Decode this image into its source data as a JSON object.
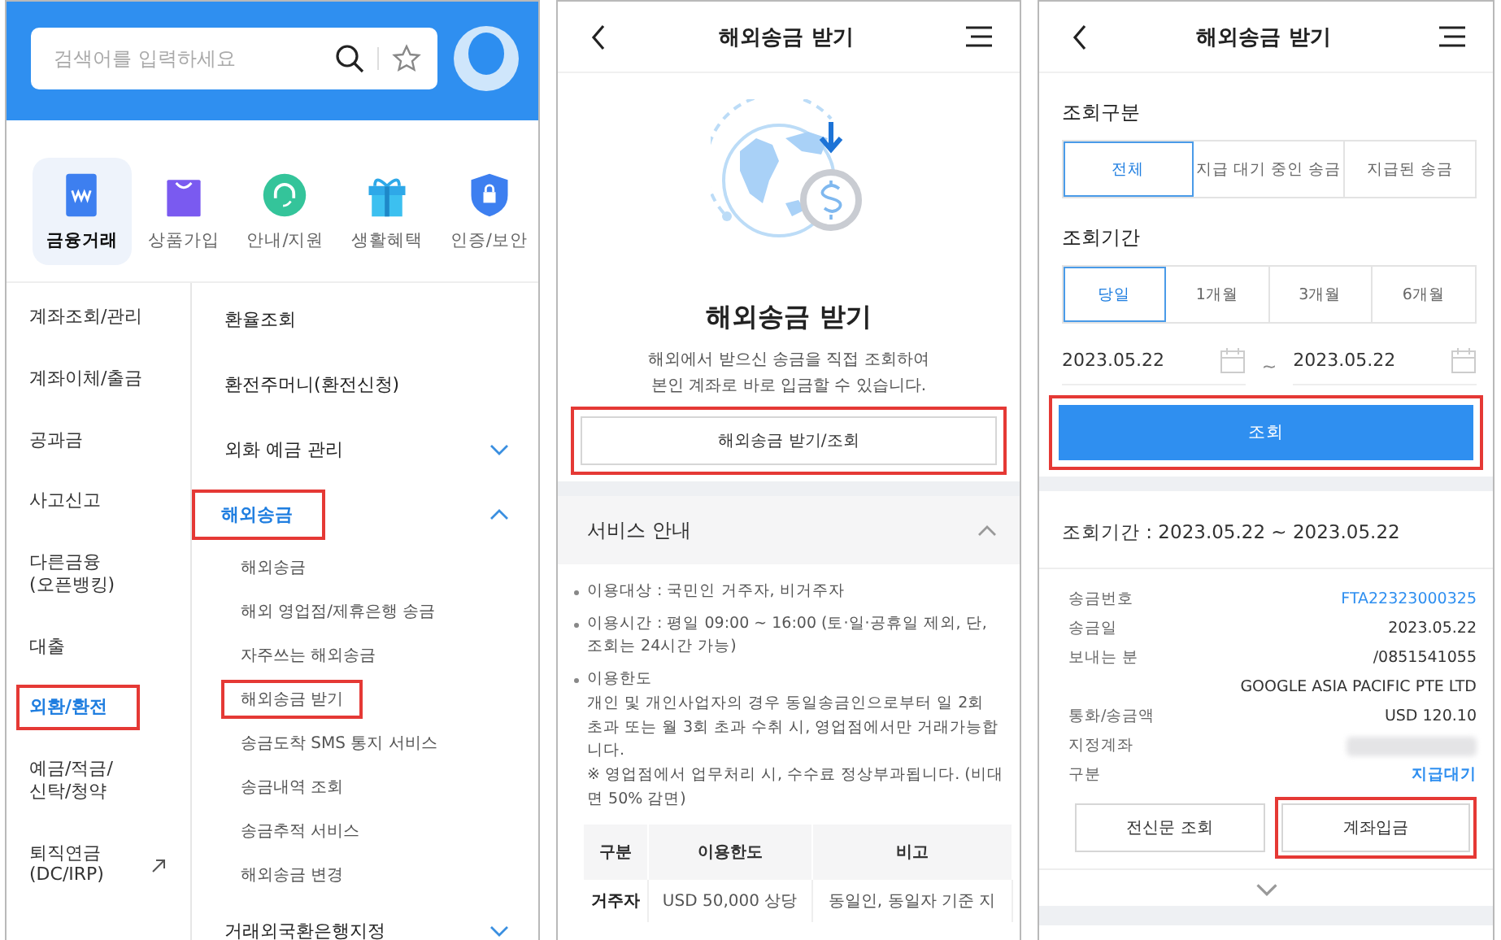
{
  "menu_screen": {
    "search": {
      "placeholder": "검색어를 입력하세요"
    },
    "categories": [
      {
        "label": "금융거래",
        "kind": "finance",
        "selected": true
      },
      {
        "label": "상품가입",
        "kind": "shop",
        "selected": false
      },
      {
        "label": "안내/지원",
        "kind": "support",
        "selected": false
      },
      {
        "label": "생활혜택",
        "kind": "gift",
        "selected": false
      },
      {
        "label": "인증/보안",
        "kind": "security",
        "selected": false
      }
    ],
    "left_menu": [
      {
        "label": "계좌조회/관리",
        "selected": false,
        "highlighted": false,
        "external": false
      },
      {
        "label": "계좌이체/출금",
        "selected": false,
        "highlighted": false,
        "external": false
      },
      {
        "label": "공과금",
        "selected": false,
        "highlighted": false,
        "external": false
      },
      {
        "label": "사고신고",
        "selected": false,
        "highlighted": false,
        "external": false
      },
      {
        "label": "다른금융\n(오픈뱅킹)",
        "selected": false,
        "highlighted": false,
        "external": false
      },
      {
        "label": "대출",
        "selected": false,
        "highlighted": false,
        "external": false
      },
      {
        "label": "외환/환전",
        "selected": true,
        "highlighted": true,
        "external": false
      },
      {
        "label": "예금/적금/\n신탁/청약",
        "selected": false,
        "highlighted": false,
        "external": false
      },
      {
        "label": "퇴직연금\n(DC/IRP)",
        "selected": false,
        "highlighted": false,
        "external": true
      }
    ],
    "right_menu": [
      {
        "label": "환율조회",
        "kind": "link",
        "selected": false,
        "highlighted": false
      },
      {
        "label": "환전주머니(환전신청)",
        "kind": "link",
        "selected": false,
        "highlighted": false
      },
      {
        "label": "외화 예금 관리",
        "kind": "group",
        "expanded": false,
        "selected": false,
        "highlighted": false
      },
      {
        "label": "해외송금",
        "kind": "group",
        "expanded": true,
        "selected": true,
        "highlighted": true,
        "children": [
          {
            "label": "해외송금",
            "highlighted": false
          },
          {
            "label": "해외 영업점/제휴은행 송금",
            "highlighted": false
          },
          {
            "label": "자주쓰는 해외송금",
            "highlighted": false
          },
          {
            "label": "해외송금 받기",
            "highlighted": true
          },
          {
            "label": "송금도착 SMS 통지 서비스",
            "highlighted": false
          },
          {
            "label": "송금내역 조회",
            "highlighted": false
          },
          {
            "label": "송금추적 서비스",
            "highlighted": false
          },
          {
            "label": "해외송금 변경",
            "highlighted": false
          }
        ]
      },
      {
        "label": "거래외국환은행지정",
        "kind": "group",
        "expanded": false,
        "selected": false,
        "highlighted": false
      }
    ]
  },
  "intro_screen": {
    "header": {
      "title": "해외송금 받기"
    },
    "heading": "해외송금 받기",
    "description": [
      "해외에서 받으신 송금을 직접 조회하여",
      "본인 계좌로 바로 입금할 수 있습니다."
    ],
    "button": {
      "label": "해외송금 받기/조회",
      "highlighted": true
    },
    "service_info": {
      "title": "서비스 안내",
      "expanded": true,
      "items": [
        {
          "text": "이용대상 : 국민인 거주자, 비거주자"
        },
        {
          "text": "이용시간 : 평일 09:00 ~ 16:00 (토·일·공휴일 제외, 단, 조회는 24시간 가능)"
        },
        {
          "text": "이용한도",
          "details": [
            "개인 및 개인사업자의 경우 동일송금인으로부터 일 2회 초과 또는 월 3회 초과 수취 시, 영업점에서만 거래가능합니다.",
            "※ 영업점에서 업무처리 시, 수수료 정상부과됩니다. (비대면 50% 감면)"
          ]
        }
      ],
      "table": {
        "columns": [
          "구분",
          "이용한도",
          "비고"
        ],
        "rows": [
          [
            "거주자",
            "USD 50,000 상당",
            "동일인, 동일자 기준 지"
          ]
        ]
      }
    }
  },
  "inquiry_screen": {
    "header": {
      "title": "해외송금 받기"
    },
    "type_label": "조회구분",
    "type_options": [
      {
        "label": "전체",
        "selected": true
      },
      {
        "label": "지급 대기 중인 송금",
        "selected": false
      },
      {
        "label": "지급된 송금",
        "selected": false
      }
    ],
    "period_label": "조회기간",
    "period_options": [
      {
        "label": "당일",
        "selected": true
      },
      {
        "label": "1개월",
        "selected": false
      },
      {
        "label": "3개월",
        "selected": false
      },
      {
        "label": "6개월",
        "selected": false
      }
    ],
    "date_from": "2023.05.22",
    "date_separator": "~",
    "date_to": "2023.05.22",
    "search_button": {
      "label": "조회",
      "highlighted": true
    },
    "result": {
      "period_text": "조회기간 : 2023.05.22 ~ 2023.05.22",
      "fields": [
        {
          "label": "송금번호",
          "kind": "link",
          "lines": [
            "FTA22323000325"
          ]
        },
        {
          "label": "송금일",
          "kind": "plain",
          "lines": [
            "2023.05.22"
          ]
        },
        {
          "label": "보내는 분",
          "kind": "plain",
          "lines": [
            "/0851541055",
            "GOOGLE ASIA PACIFIC PTE LTD"
          ]
        },
        {
          "label": "통화/송금액",
          "kind": "plain",
          "lines": [
            "USD 120.10"
          ]
        },
        {
          "label": "지정계좌",
          "kind": "masked"
        },
        {
          "label": "구분",
          "kind": "status",
          "lines": [
            "지급대기"
          ]
        }
      ],
      "actions": [
        {
          "label": "전신문 조회",
          "highlighted": false
        },
        {
          "label": "계좌입금",
          "highlighted": true
        }
      ],
      "expanded": false
    }
  }
}
